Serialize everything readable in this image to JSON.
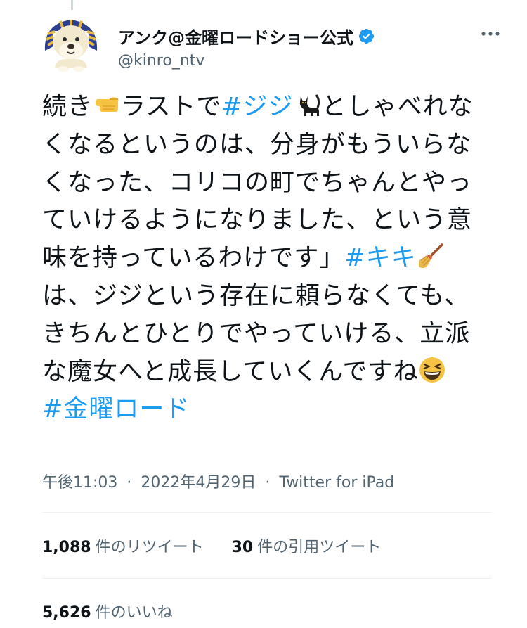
{
  "account": {
    "display_name": "アンク@金曜ロードショー公式",
    "handle": "@kinro_ntv",
    "verified_badge_icon": "verified-badge-icon",
    "more_icon": "more-horizontal-icon",
    "avatar_icon": "sphinx-dog-avatar"
  },
  "tweet": {
    "segments": {
      "s1": "続き",
      "s2": "ラストで",
      "h1": "#ジジ",
      "s3": "としゃべれなくなるというのは、分身がもういらなくなった、コリコの町でちゃんとやっていけるようになりました、という意味を持っているわけです」",
      "h2": "#キキ",
      "s4": "は、ジジという存在に頼らなくても、きちんとひとりでやっていける、立派な魔女へと成長していくんですね",
      "h3": "#金曜ロード"
    },
    "emojis": [
      "pointing-right-emoji",
      "black-cat-emoji",
      "broom-emoji",
      "grinning-squinting-emoji"
    ]
  },
  "meta": {
    "time": "午後11:03",
    "date": "2022年4月29日",
    "separator": "·",
    "source": "Twitter for iPad"
  },
  "stats": {
    "retweets_count": "1,088",
    "retweets_label": "件のリツイート",
    "quotes_count": "30",
    "quotes_label": "件の引用ツイート",
    "likes_count": "5,626",
    "likes_label": "件のいいね"
  },
  "colors": {
    "link": "#1d9bf0",
    "text": "#0f1419",
    "secondary": "#536471",
    "divider": "#eff3f4"
  }
}
